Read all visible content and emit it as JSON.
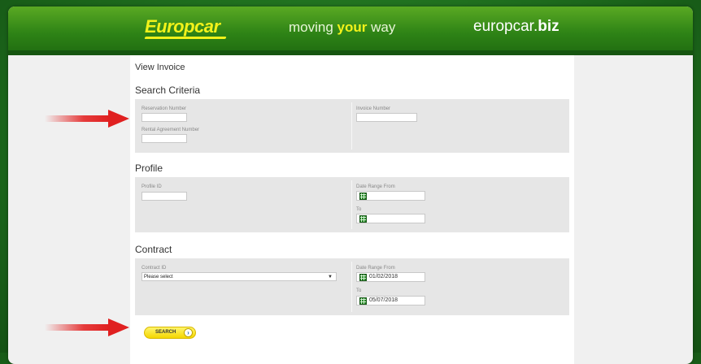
{
  "header": {
    "logo": "Europcar",
    "tagline_pre": "moving ",
    "tagline_hl": "your",
    "tagline_post": " way",
    "biz_pre": "europcar.",
    "biz_bold": "biz"
  },
  "page_title": "View Invoice",
  "search_criteria": {
    "title": "Search Criteria",
    "reservation_label": "Reservation Number",
    "rental_label": "Rental Agreement Number",
    "invoice_label": "Invoice Number"
  },
  "profile": {
    "title": "Profile",
    "profile_id_label": "Profile ID",
    "date_from_label": "Date Range From",
    "date_to_label": "To"
  },
  "contract": {
    "title": "Contract",
    "contract_id_label": "Contract ID",
    "contract_select": "Please select",
    "date_from_label": "Date Range From",
    "date_from_value": "01/02/2018",
    "date_to_label": "To",
    "date_to_value": "05/07/2018"
  },
  "search_button": "SEARCH",
  "colors": {
    "brand_green": "#2e8316",
    "brand_yellow": "#f2f21a",
    "arrow_red": "#e02020"
  }
}
